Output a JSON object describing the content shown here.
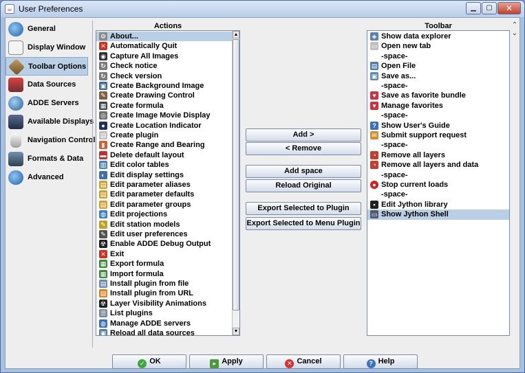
{
  "window": {
    "title": "User Preferences"
  },
  "sidebar": {
    "items": [
      {
        "label": "General",
        "icon": "globe-icon"
      },
      {
        "label": "Display Window",
        "icon": "display-window-icon"
      },
      {
        "label": "Toolbar Options",
        "icon": "toolbar-options-icon",
        "selected": true
      },
      {
        "label": "Data Sources",
        "icon": "data-sources-icon"
      },
      {
        "label": "ADDE Servers",
        "icon": "adde-servers-icon"
      },
      {
        "label": "Available Displays",
        "icon": "monitor-icon"
      },
      {
        "label": "Navigation Controls",
        "icon": "mouse-icon"
      },
      {
        "label": "Formats & Data",
        "icon": "formats-icon"
      },
      {
        "label": "Advanced",
        "icon": "advanced-globe-icon"
      }
    ]
  },
  "actions": {
    "header": "Actions",
    "items": [
      "About...",
      "Automatically Quit",
      "Capture All Images",
      "Check notice",
      "Check version",
      "Create Background Image",
      "Create Drawing Control",
      "Create formula",
      "Create Image Movie Display",
      "Create Location Indicator",
      "Create plugin",
      "Create Range and Bearing",
      "Delete default layout",
      "Edit color tables",
      "Edit display settings",
      "Edit parameter aliases",
      "Edit parameter defaults",
      "Edit parameter groups",
      "Edit projections",
      "Edit station models",
      "Edit user preferences",
      "Enable ADDE Debug Output",
      "Exit",
      "Export formula",
      "Import formula",
      "Install plugin from file",
      "Install plugin from URL",
      "Layer Visibility Animations",
      "List plugins",
      "Manage ADDE servers",
      "Reload all data sources"
    ]
  },
  "toolbar": {
    "header": "Toolbar",
    "items": [
      "Show data explorer",
      "Open new tab",
      "-space-",
      "Open File",
      "Save as...",
      "-space-",
      "Save as favorite bundle",
      "Manage favorites",
      "-space-",
      "Show User's Guide",
      "Submit support request",
      "-space-",
      "Remove all layers",
      "Remove all layers and data",
      "-space-",
      "Stop current loads",
      "-space-",
      "Edit Jython library",
      "Show Jython Shell"
    ]
  },
  "buttons": {
    "add": "Add  >",
    "remove": "<  Remove",
    "add_space": "Add space",
    "reload_original": "Reload Original",
    "export_plugin": "Export Selected to Plugin",
    "export_menu_plugin": "Export Selected to Menu Plugin"
  },
  "footer": {
    "ok": "OK",
    "apply": "Apply",
    "cancel": "Cancel",
    "help": "Help"
  }
}
